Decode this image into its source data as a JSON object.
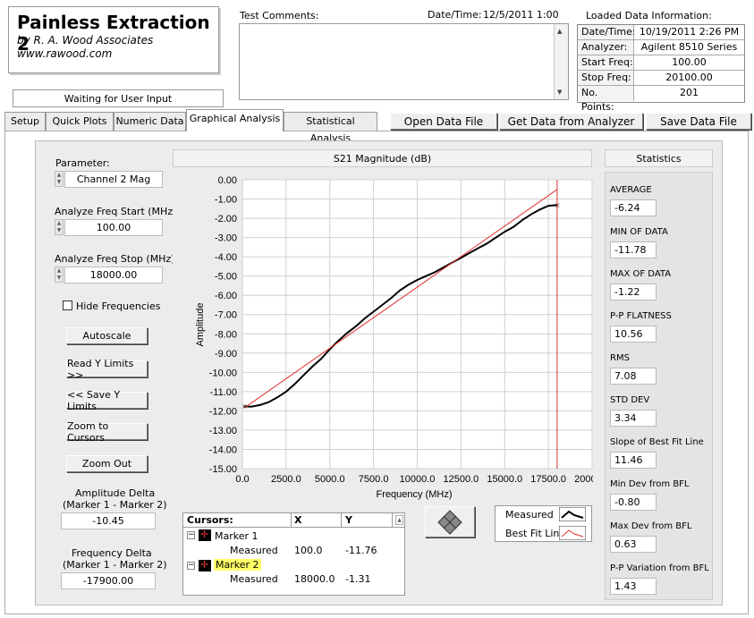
{
  "app": {
    "title": "Painless Extraction 2",
    "author": "by R. A. Wood Associates",
    "website": "www.rawood.com",
    "status": "Waiting for User Input"
  },
  "header": {
    "comments_label": "Test Comments:",
    "datetime_label": "Date/Time:",
    "datetime_value": "12/5/2011  1:00",
    "loaded_title": "Loaded Data Information:",
    "loaded": [
      {
        "key": "Date/Time:",
        "value": "10/19/2011 2:26 PM"
      },
      {
        "key": "Analyzer:",
        "value": "Agilent 8510 Series"
      },
      {
        "key": "Start Freq:",
        "value": "100.00"
      },
      {
        "key": "Stop Freq:",
        "value": "20100.00"
      },
      {
        "key": "No. Points:",
        "value": "201"
      }
    ]
  },
  "tabs": [
    "Setup",
    "Quick Plots",
    "Numeric Data",
    "Graphical Analysis",
    "Statistical Analysis"
  ],
  "toolbar": {
    "open": "Open Data File",
    "get": "Get Data from Analyzer",
    "save": "Save Data File"
  },
  "controls": {
    "parameter_label": "Parameter:",
    "parameter_value": "Channel 2 Mag",
    "start_label": "Analyze Freq Start (MHz)",
    "start_value": "100.00",
    "stop_label": "Analyze Freq Stop (MHz)",
    "stop_value": "18000.00",
    "hide_freq": "Hide Frequencies",
    "autoscale": "Autoscale",
    "read_y": "Read Y Limits >>",
    "save_y": "<< Save Y Limits",
    "zoom_cursors": "Zoom to Cursors",
    "zoom_out": "Zoom Out",
    "amp_delta_label1": "Amplitude Delta",
    "amp_delta_label2": "(Marker 1 - Marker 2)",
    "amp_delta_value": "-10.45",
    "freq_delta_label1": "Frequency Delta",
    "freq_delta_label2": "(Marker 1 - Marker 2)",
    "freq_delta_value": "-17900.00"
  },
  "chart_data": {
    "type": "line",
    "title": "S21 Magnitude (dB)",
    "xlabel": "Frequency (MHz)",
    "ylabel": "Amplitude",
    "xlim": [
      0,
      20000
    ],
    "ylim": [
      -15,
      0
    ],
    "xticks": [
      "0.0",
      "2500.0",
      "5000.0",
      "7500.0",
      "10000.0",
      "12500.0",
      "15000.0",
      "17500.0",
      "20000.0"
    ],
    "yticks": [
      "0.00",
      "-1.00",
      "-2.00",
      "-3.00",
      "-4.00",
      "-5.00",
      "-6.00",
      "-7.00",
      "-8.00",
      "-9.00",
      "-10.00",
      "-11.00",
      "-12.00",
      "-13.00",
      "-14.00",
      "-15.00"
    ],
    "grid": true,
    "series": [
      {
        "name": "Measured",
        "color": "#000000",
        "x": [
          100,
          500,
          1000,
          1500,
          2000,
          2500,
          3000,
          3500,
          4000,
          4500,
          5000,
          5500,
          6000,
          6500,
          7000,
          7500,
          8000,
          8500,
          9000,
          9500,
          10000,
          10500,
          11000,
          11500,
          12000,
          12500,
          13000,
          13500,
          14000,
          14500,
          15000,
          15500,
          16000,
          16500,
          17000,
          17500,
          18000
        ],
        "y": [
          -11.76,
          -11.78,
          -11.7,
          -11.55,
          -11.3,
          -11.0,
          -10.6,
          -10.15,
          -9.7,
          -9.3,
          -8.8,
          -8.35,
          -7.95,
          -7.6,
          -7.2,
          -6.85,
          -6.5,
          -6.15,
          -5.75,
          -5.45,
          -5.2,
          -5.0,
          -4.8,
          -4.55,
          -4.3,
          -4.05,
          -3.8,
          -3.55,
          -3.3,
          -3.0,
          -2.7,
          -2.45,
          -2.1,
          -1.8,
          -1.55,
          -1.35,
          -1.31
        ]
      },
      {
        "name": "Best Fit Line",
        "color": "#e03030",
        "x": [
          100,
          18000
        ],
        "y": [
          -11.85,
          -0.5
        ]
      }
    ],
    "cursors": [
      {
        "x": 18000,
        "label": "Marker 2"
      }
    ]
  },
  "cursors_table": {
    "head_name": "Cursors:",
    "head_x": "X",
    "head_y": "Y",
    "rows": [
      {
        "marker": "Marker 1",
        "sub": "Measured",
        "x": "100.0",
        "y": "-11.76"
      },
      {
        "marker": "Marker 2",
        "sub": "Measured",
        "x": "18000.0",
        "y": "-1.31"
      }
    ]
  },
  "legend": {
    "measured": "Measured",
    "bestfit": "Best Fit Line"
  },
  "statistics": {
    "title": "Statistics",
    "items": [
      {
        "label": "AVERAGE",
        "value": "-6.24"
      },
      {
        "label": "MIN OF DATA",
        "value": "-11.78"
      },
      {
        "label": "MAX OF DATA",
        "value": "-1.22"
      },
      {
        "label": "P-P FLATNESS",
        "value": "10.56"
      },
      {
        "label": "RMS",
        "value": "7.08"
      },
      {
        "label": "STD DEV",
        "value": "3.34"
      },
      {
        "label": "Slope of Best Fit Line",
        "value": "11.46"
      },
      {
        "label": "Min Dev from BFL",
        "value": "-0.80"
      },
      {
        "label": "Max Dev from BFL",
        "value": "0.63"
      },
      {
        "label": "P-P Variation from BFL",
        "value": "1.43"
      }
    ]
  }
}
